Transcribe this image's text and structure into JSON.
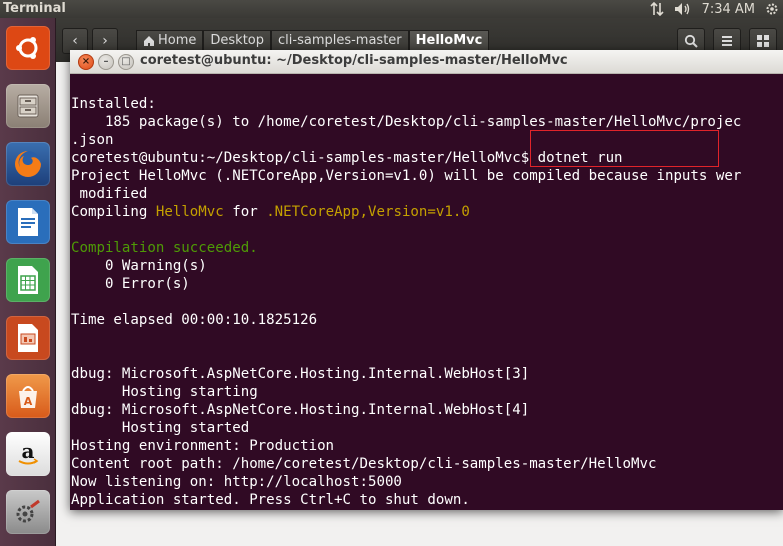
{
  "top_panel": {
    "app_title": "Terminal",
    "time": "7:34 AM"
  },
  "launcher": {
    "items": [
      {
        "name": "ubuntu-dash",
        "icon": "ubuntu-logo-icon",
        "color": "#dd4814"
      },
      {
        "name": "files",
        "icon": "file-cabinet-icon",
        "color": "#9a8f84"
      },
      {
        "name": "firefox",
        "icon": "firefox-icon",
        "color": "#e66000"
      },
      {
        "name": "writer",
        "icon": "libreoffice-writer-icon",
        "color": "#2a6ebb"
      },
      {
        "name": "calc",
        "icon": "libreoffice-calc-icon",
        "color": "#3fa34d"
      },
      {
        "name": "impress",
        "icon": "libreoffice-impress-icon",
        "color": "#c8491f"
      },
      {
        "name": "software-center",
        "icon": "software-center-icon",
        "color": "#e8722a"
      },
      {
        "name": "amazon",
        "icon": "amazon-icon",
        "color": "#f2f2f2"
      },
      {
        "name": "system-settings",
        "icon": "settings-gears-icon",
        "color": "#8a8a8a"
      }
    ]
  },
  "file_manager": {
    "breadcrumbs": [
      {
        "label": "Home",
        "icon": "home-icon"
      },
      {
        "label": "Desktop"
      },
      {
        "label": "cli-samples-master"
      },
      {
        "label": "HelloMvc",
        "active": true
      }
    ]
  },
  "terminal": {
    "title": "coretest@ubuntu: ~/Desktop/cli-samples-master/HelloMvc",
    "lines": [
      [
        {
          "t": "Installed:"
        }
      ],
      [
        {
          "t": "    185 package(s) to /home/coretest/Desktop/cli-samples-master/HelloMvc/projec"
        }
      ],
      [
        {
          "t": ".json"
        }
      ],
      [
        {
          "t": "coretest@ubuntu:~/Desktop/cli-samples-master/HelloMvc$ dotnet run"
        }
      ],
      [
        {
          "t": "Project HelloMvc (.NETCoreApp,Version=v1.0) will be compiled because inputs wer"
        }
      ],
      [
        {
          "t": " modified"
        }
      ],
      [
        {
          "t": "Compiling "
        },
        {
          "t": "HelloMvc",
          "c": "yellow"
        },
        {
          "t": " for "
        },
        {
          "t": ".NETCoreApp,Version=v1.0",
          "c": "yellow"
        }
      ],
      [
        {
          "t": ""
        }
      ],
      [
        {
          "t": "Compilation succeeded.",
          "c": "green"
        }
      ],
      [
        {
          "t": "    0 Warning(s)"
        }
      ],
      [
        {
          "t": "    0 Error(s)"
        }
      ],
      [
        {
          "t": ""
        }
      ],
      [
        {
          "t": "Time elapsed 00:00:10.1825126"
        }
      ],
      [
        {
          "t": ""
        }
      ],
      [
        {
          "t": ""
        }
      ],
      [
        {
          "t": "dbug: Microsoft.AspNetCore.Hosting.Internal.WebHost[3]"
        }
      ],
      [
        {
          "t": "      Hosting starting"
        }
      ],
      [
        {
          "t": "dbug: Microsoft.AspNetCore.Hosting.Internal.WebHost[4]"
        }
      ],
      [
        {
          "t": "      Hosting started"
        }
      ],
      [
        {
          "t": "Hosting environment: Production"
        }
      ],
      [
        {
          "t": "Content root path: /home/coretest/Desktop/cli-samples-master/HelloMvc"
        }
      ],
      [
        {
          "t": "Now listening on: http://localhost:5000"
        }
      ],
      [
        {
          "t": "Application started. Press Ctrl+C to shut down."
        }
      ]
    ]
  }
}
